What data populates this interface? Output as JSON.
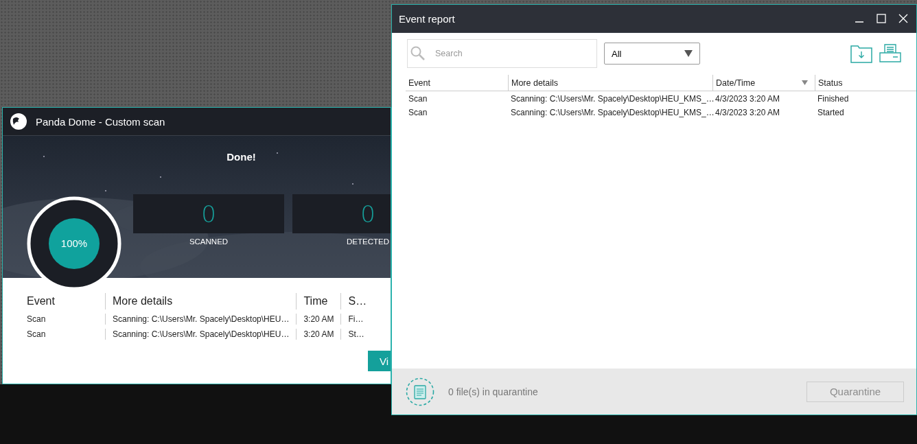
{
  "scan_window": {
    "title": "Panda Dome - Custom scan",
    "heading": "Done!",
    "progress": {
      "label": "100%",
      "level": 1
    },
    "stats": [
      {
        "value": "0",
        "label": "SCANNED"
      },
      {
        "value": "0",
        "label": "DETECTED"
      }
    ],
    "table": {
      "columns": [
        "Event",
        "More details",
        "Time",
        "S…"
      ],
      "rows": [
        [
          "Scan",
          "Scanning: C:\\Users\\Mr. Spacely\\Desktop\\HEU…",
          "3:20 AM",
          "Fi…"
        ],
        [
          "Scan",
          "Scanning: C:\\Users\\Mr. Spacely\\Desktop\\HEU…",
          "3:20 AM",
          "St…"
        ]
      ]
    },
    "button": "Vi"
  },
  "report_window": {
    "title": "Event report",
    "search": {
      "placeholder": "Search"
    },
    "filter": "All",
    "table": {
      "columns": [
        {
          "label": "Event",
          "sorted": false
        },
        {
          "label": "More details",
          "sorted": false
        },
        {
          "label": "Date/Time",
          "sorted": true
        },
        {
          "label": "Status",
          "sorted": false
        }
      ],
      "rows": [
        [
          "Scan",
          "Scanning: C:\\Users\\Mr. Spacely\\Desktop\\HEU_KMS_…",
          "4/3/2023 3:20 AM",
          "Finished"
        ],
        [
          "Scan",
          "Scanning: C:\\Users\\Mr. Spacely\\Desktop\\HEU_KMS_…",
          "4/3/2023 3:20 AM",
          "Started"
        ]
      ]
    },
    "quarantine_count": "0 file(s) in quarantine",
    "quarantine_button": {
      "label": "Quarantine",
      "disabled": true
    }
  }
}
